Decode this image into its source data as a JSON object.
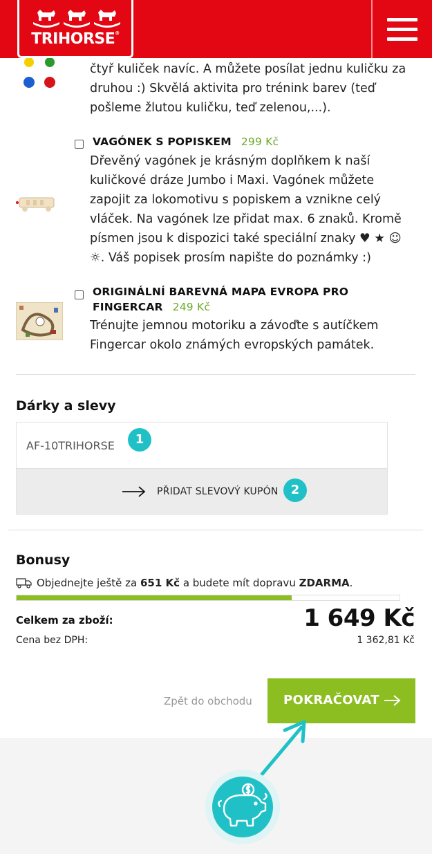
{
  "header": {
    "logo_text": "TRIHORSE",
    "logo_mark": "®",
    "menu_icon": "hamburger-menu-icon"
  },
  "products": [
    {
      "description": "čtyř kuliček navíc. A můžete posílat jednu kuličku za druhou :) Skvělá aktivita pro trénink barev (teď pošleme žlutou kuličku, teď zelenou,...).",
      "lines": [
        "čtyř kuliček navíc. A můžete posílat jednu kuličku za",
        "druhou :) Skvělá aktivita pro trénink barev (teď",
        "pošleme žlutou kuličku, teď zelenou,...)."
      ]
    },
    {
      "title": "VAGÓNEK S POPISKEM",
      "price": "299 Kč",
      "lines": [
        "Dřevěný vagónek je krásným doplňkem k naší",
        "kuličkové dráze Jumbo i Maxi. Vagónek můžete",
        "zapojit za lokomotivu s popiskem a vznikne celý",
        "vláček. Na vagónek lze přidat max. 6 znaků. Kromě",
        "písmen jsou k dispozici také speciální znaky ♥ ★ ☺",
        "☼. Váš popisek prosím napište do poznámky :)"
      ]
    },
    {
      "title_line1": "ORIGINÁLNÍ BAREVNÁ MAPA EVROPA PRO",
      "title_line2": "FINGERCAR",
      "price": "249 Kč",
      "lines": [
        "Trénujte jemnou motoriku a závoďte s autíčkem",
        "Fingercar okolo známých evropských památek."
      ]
    }
  ],
  "gifts": {
    "title": "Dárky a slevy",
    "coupon_value": "AF-10TRIHORSE",
    "add_coupon_label": "PŘIDAT SLEVOVÝ KUPÓN",
    "badge1": "1",
    "badge2": "2"
  },
  "bonus": {
    "title": "Bonusy",
    "text_before": "Objednejte ještě za",
    "amount": "651 Kč",
    "text_middle": "a budete mít dopravu",
    "free": "ZDARMA",
    "text_after": ".",
    "progress_fraction": 0.718
  },
  "totals": {
    "total_label": "Celkem za zboží:",
    "total_value": "1 649 Kč",
    "net_label": "Cena bez DPH:",
    "net_value": "1 362,81 Kč"
  },
  "actions": {
    "back_label": "Zpět do obchodu",
    "continue_label": "POKRAČOVAT"
  },
  "colors": {
    "brand_red": "#e30613",
    "accent_green": "#8cbe22",
    "price_green": "#6aaa2a",
    "annotation_teal": "#20c1c6"
  }
}
